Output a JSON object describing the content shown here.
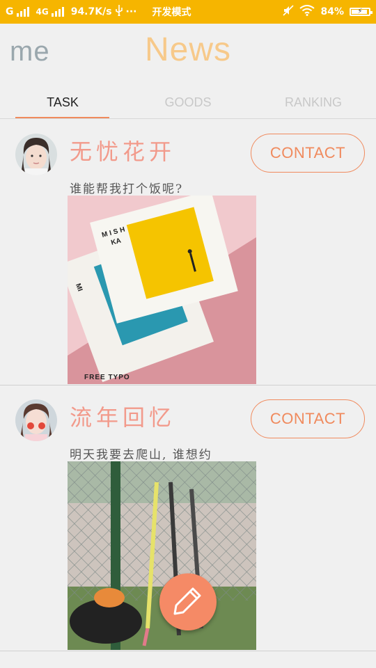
{
  "status_bar": {
    "carrier": "G",
    "network": "4G",
    "speed": "94.7K/s",
    "usb_icon": "usb-icon",
    "dots": "···",
    "mode": "开发模式",
    "battery": "84%"
  },
  "header": {
    "me_label": "me",
    "title": "News"
  },
  "tabs": [
    {
      "label": "TASK",
      "active": true
    },
    {
      "label": "GOODS",
      "active": false
    },
    {
      "label": "RANKING",
      "active": false
    }
  ],
  "posts": [
    {
      "name": "无忧花开",
      "contact_label": "CONTACT",
      "text": "谁能帮我打个饭呢?",
      "image_caption": "FREE TYPO",
      "poster_title_a": "MISH",
      "poster_title_b": "KA"
    },
    {
      "name": "流年回忆",
      "contact_label": "CONTACT",
      "text": "明天我要去爬山, 谁想约"
    }
  ],
  "colors": {
    "status_bar": "#f6b500",
    "accent": "#f08a5d",
    "name": "#f29a8b",
    "title": "#f7c98a",
    "fab": "#f58a66"
  }
}
